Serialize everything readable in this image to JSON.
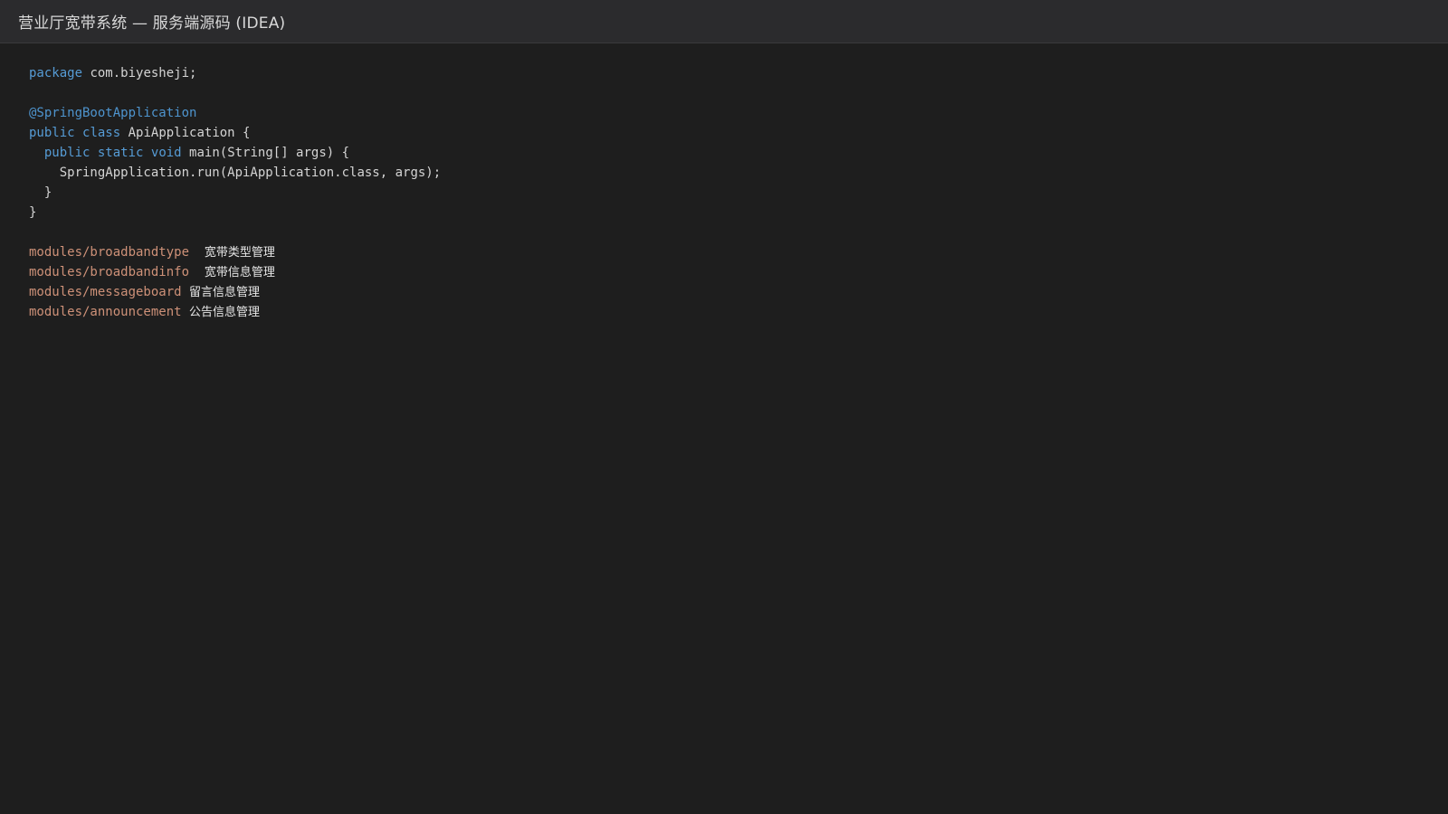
{
  "window": {
    "title": "营业厅宽带系统 — 服务端源码 (IDEA)"
  },
  "code": {
    "pkg_kw": "package",
    "pkg_name": "com.biyesheji;",
    "annotation": "@SpringBootApplication",
    "cls_public": "public",
    "cls_class": "class",
    "cls_name": "ApiApplication {",
    "m_public": "public",
    "m_static": "static",
    "m_void": "void",
    "m_sig": "main(String[] args) {",
    "body": "SpringApplication.run(ApiApplication.class, args);",
    "close_method": "}",
    "close_class": "}"
  },
  "modules": [
    {
      "path": "modules/broadbandtype",
      "desc": "宽带类型管理"
    },
    {
      "path": "modules/broadbandinfo",
      "desc": "宽带信息管理"
    },
    {
      "path": "modules/messageboard",
      "desc": "留言信息管理"
    },
    {
      "path": "modules/announcement",
      "desc": "公告信息管理"
    }
  ],
  "colors": {
    "keyword": "#569cd6",
    "annotation": "#4e94ce",
    "path": "#ce9178",
    "text": "#d4d4d4",
    "background": "#1e1e1e",
    "titlebar": "#2b2b2d"
  }
}
